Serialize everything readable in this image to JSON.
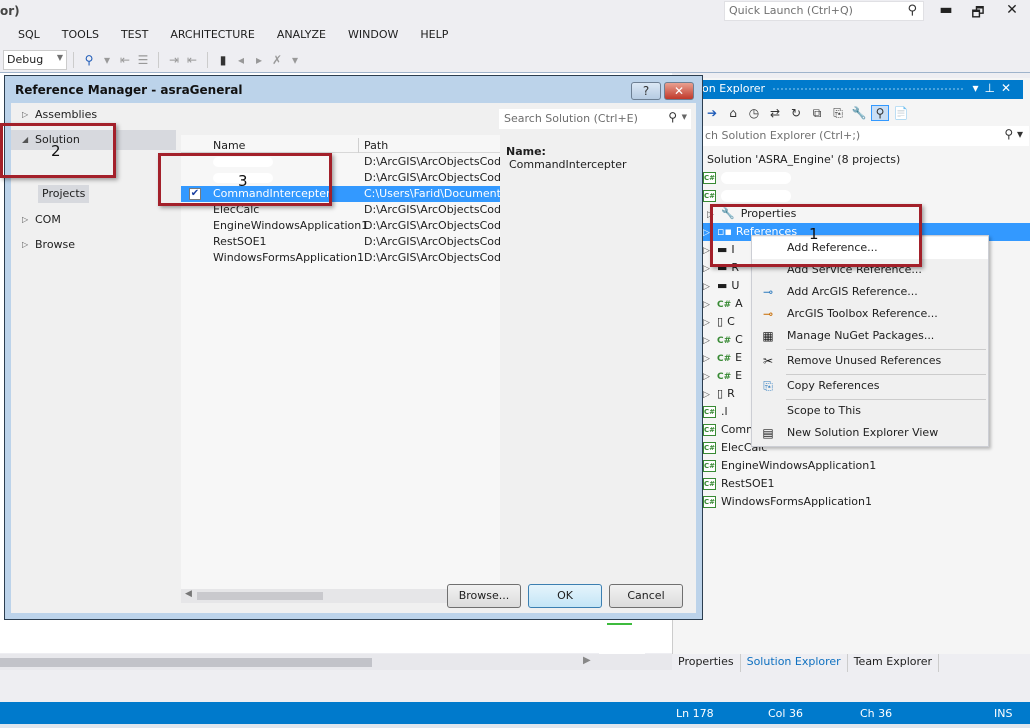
{
  "window": {
    "title_fragment": "or)",
    "quick_launch_placeholder": "Quick Launch (Ctrl+Q)",
    "controls": {
      "minimize": "▬",
      "restore": "🗗",
      "close": "✕"
    }
  },
  "menu": [
    "SQL",
    "TOOLS",
    "TEST",
    "ARCHITECTURE",
    "ANALYZE",
    "WINDOW",
    "HELP"
  ],
  "toolbar": {
    "configuration": "Debug",
    "icons": [
      "find-in-files-icon",
      "overflow-icon",
      "indent-icon",
      "outdent-icon",
      "comment-icon",
      "uncomment-icon",
      "bookmark-icon",
      "prev-bookmark-icon",
      "next-bookmark-icon",
      "clear-bookmarks-icon",
      "overflow-icon"
    ]
  },
  "dialog": {
    "title": "Reference Manager - asraGeneral",
    "help_label": "?",
    "close_label": "✕",
    "nav": [
      {
        "label": "Assemblies",
        "expanded": false
      },
      {
        "label": "Solution",
        "expanded": true,
        "children": [
          "Projects"
        ]
      },
      {
        "label": "COM",
        "expanded": false
      },
      {
        "label": "Browse",
        "expanded": false
      }
    ],
    "search_placeholder": "Search Solution (Ctrl+E)",
    "columns": [
      "Name",
      "Path"
    ],
    "rows": [
      {
        "name": "",
        "path": "D:\\ArcGIS\\ArcObjectsCodes",
        "checked": false,
        "selected": false,
        "redacted": true
      },
      {
        "name": "",
        "path": "D:\\ArcGIS\\ArcObjectsCodes",
        "checked": false,
        "selected": false,
        "redacted": true
      },
      {
        "name": "CommandIntercepter",
        "path": "C:\\Users\\Farid\\Documents\\(",
        "checked": true,
        "selected": true
      },
      {
        "name": "ElecCalc",
        "path": "D:\\ArcGIS\\ArcObjectsCodes",
        "checked": false,
        "selected": false
      },
      {
        "name": "EngineWindowsApplication1",
        "path": "D:\\ArcGIS\\ArcObjectsCodes",
        "checked": false,
        "selected": false
      },
      {
        "name": "RestSOE1",
        "path": "D:\\ArcGIS\\ArcObjectsCodes",
        "checked": false,
        "selected": false
      },
      {
        "name": "WindowsFormsApplication1",
        "path": "D:\\ArcGIS\\ArcObjectsCodes",
        "checked": false,
        "selected": false
      }
    ],
    "details": {
      "label": "Name:",
      "value": "CommandIntercepter"
    },
    "buttons": {
      "browse": "Browse...",
      "ok": "OK",
      "cancel": "Cancel"
    }
  },
  "solution_explorer": {
    "title": "ion Explorer",
    "search_placeholder": "ch Solution Explorer (Ctrl+;)",
    "solution_label": "Solution 'ASRA_Engine' (8 projects)",
    "tree": [
      {
        "label": "",
        "kind": "csproj",
        "redacted": true
      },
      {
        "label": "",
        "kind": "csproj",
        "redacted": true
      },
      {
        "label": "Properties",
        "kind": "properties"
      },
      {
        "label": "References",
        "kind": "references",
        "selected": true
      },
      {
        "label": "I",
        "kind": "folder"
      },
      {
        "label": "R",
        "kind": "folder"
      },
      {
        "label": "U",
        "kind": "folder"
      },
      {
        "label": "A",
        "kind": "cs"
      },
      {
        "label": "C",
        "kind": "file"
      },
      {
        "label": "C",
        "kind": "cs"
      },
      {
        "label": "E",
        "kind": "cs"
      },
      {
        "label": "E",
        "kind": "cs"
      },
      {
        "label": "R",
        "kind": "file"
      },
      {
        "label": ".l",
        "kind": "csproj"
      },
      {
        "label": "Comm",
        "kind": "csproj"
      },
      {
        "label": "ElecCalc",
        "kind": "csproj"
      },
      {
        "label": "EngineWindowsApplication1",
        "kind": "csproj"
      },
      {
        "label": "RestSOE1",
        "kind": "csproj"
      },
      {
        "label": "WindowsFormsApplication1",
        "kind": "csproj"
      }
    ],
    "bottom_tabs": [
      {
        "label": "Properties",
        "active": false
      },
      {
        "label": "Solution Explorer",
        "active": true
      },
      {
        "label": "Team Explorer",
        "active": false
      }
    ]
  },
  "context_menu": [
    {
      "label": "Add Reference...",
      "icon": "",
      "highlighted": true
    },
    {
      "label": "Add Service Reference...",
      "icon": ""
    },
    {
      "label": "Add ArcGIS Reference...",
      "icon": "arcgis-reference-icon"
    },
    {
      "label": "ArcGIS Toolbox Reference...",
      "icon": "toolbox-reference-icon"
    },
    {
      "label": "Manage NuGet Packages...",
      "icon": "nuget-icon"
    },
    {
      "label": "Remove Unused References",
      "icon": "remove-references-icon",
      "separator_before": true
    },
    {
      "label": "Copy References",
      "icon": "copy-references-icon",
      "separator_before": true
    },
    {
      "label": "Scope to This",
      "icon": "",
      "separator_before": true
    },
    {
      "label": "New Solution Explorer View",
      "icon": "new-view-icon"
    }
  ],
  "annotations": [
    "1",
    "2",
    "3"
  ],
  "statusbar": {
    "ln": "Ln 178",
    "col": "Col 36",
    "ch": "Ch 36",
    "mode": "INS"
  },
  "colors": {
    "accent": "#007acc",
    "selection": "#3399ff",
    "annotation": "#a3202a"
  }
}
